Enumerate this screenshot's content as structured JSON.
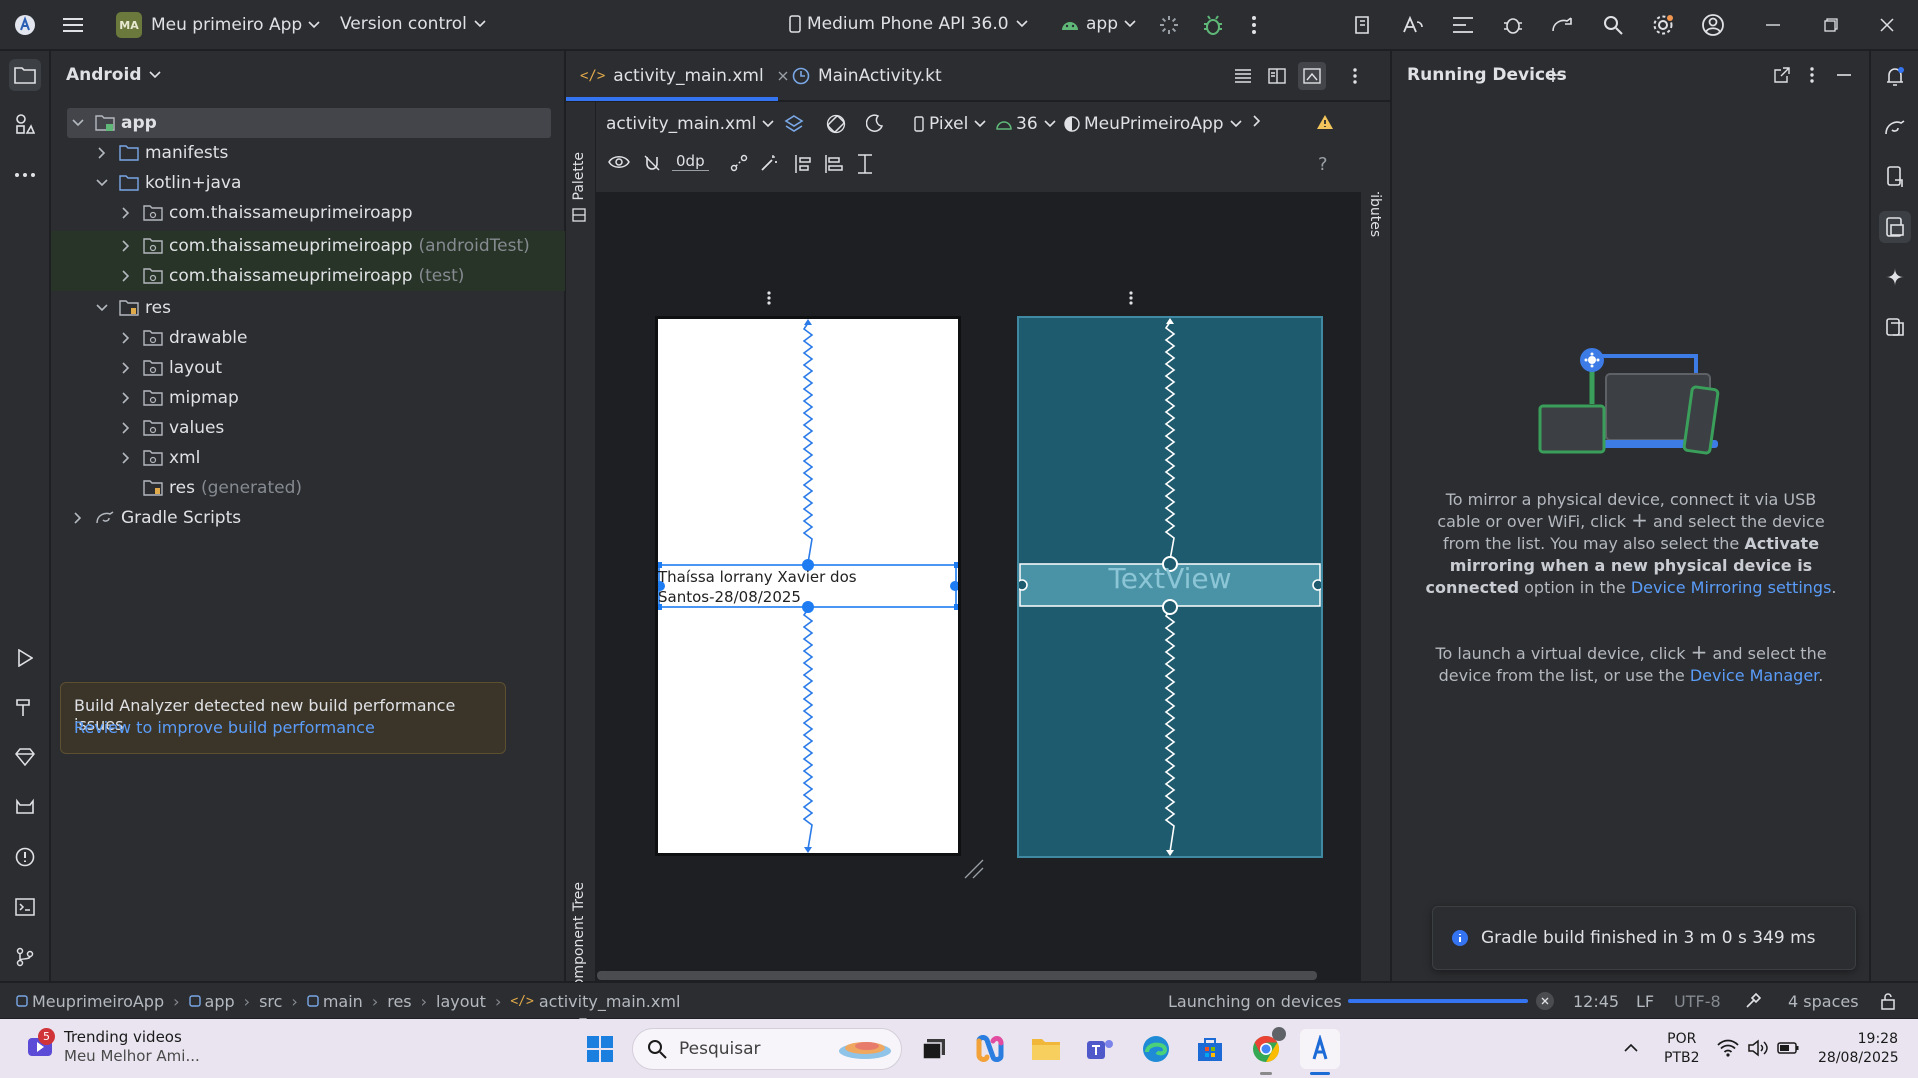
{
  "titlebar": {
    "project_initials": "MA",
    "project_name": "Meu primeiro App",
    "vcs": "Version control",
    "device": "Medium Phone API 36.0",
    "run_config": "app"
  },
  "project_panel": {
    "view_mode": "Android",
    "tree": [
      {
        "label": "app",
        "muted": ""
      },
      {
        "label": "manifests",
        "muted": ""
      },
      {
        "label": "kotlin+java",
        "muted": ""
      },
      {
        "label": "com.thaissameuprimeiroapp",
        "muted": ""
      },
      {
        "label": "com.thaissameuprimeiroapp",
        "muted": "(androidTest)"
      },
      {
        "label": "com.thaissameuprimeiroapp",
        "muted": "(test)"
      },
      {
        "label": "res",
        "muted": ""
      },
      {
        "label": "drawable",
        "muted": ""
      },
      {
        "label": "layout",
        "muted": ""
      },
      {
        "label": "mipmap",
        "muted": ""
      },
      {
        "label": "values",
        "muted": ""
      },
      {
        "label": "xml",
        "muted": ""
      },
      {
        "label": "res",
        "muted": "(generated)"
      },
      {
        "label": "Gradle Scripts",
        "muted": ""
      }
    ]
  },
  "build_popup": {
    "message": "Build Analyzer detected new build performance issues",
    "link": "Review to improve build performance"
  },
  "editor": {
    "tabs": [
      {
        "label": "activity_main.xml",
        "active": true
      },
      {
        "label": "MainActivity.kt",
        "active": false
      }
    ],
    "layout_file": "activity_main.xml",
    "device": "Pixel",
    "api": "36",
    "theme": "MeuPrimeiroApp",
    "margin": "0dp",
    "palette_label": "Palette",
    "component_tree_label": "Component Tree",
    "attributes_label": "Attributes",
    "design_text": "Thaíssa lorrany Xavier dos Santos-28/08/2025",
    "blueprint_text": "TextView"
  },
  "running_devices": {
    "title": "Running Devices",
    "p1_a": "To mirror a physical device, connect it via USB cable or over WiFi, click",
    "p1_b": "and select the device from the list. You may also select the",
    "p1_bold": "Activate mirroring when a new physical device is connected",
    "p1_c": "option in the",
    "p1_link": "Device Mirroring settings",
    "p2_a": "To launch a virtual device, click",
    "p2_b": "and select the device from the list, or use the",
    "p2_link": "Device Manager"
  },
  "gradle_toast": "Gradle build finished in 3 m 0 s 349 ms",
  "statusbar": {
    "breadcrumb": [
      "MeuprimeiroApp",
      "app",
      "src",
      "main",
      "res",
      "layout",
      "activity_main.xml"
    ],
    "task": "Launching on devices",
    "task_progress": 1.0,
    "position": "12:45",
    "line_sep": "LF",
    "encoding": "UTF-8",
    "indent": "4 spaces"
  },
  "taskbar": {
    "news_badge": "5",
    "news_title": "Trending videos",
    "news_sub": "Meu Melhor Ami...",
    "search_placeholder": "Pesquisar",
    "lang": "POR",
    "layout": "PTB2",
    "time": "19:28",
    "date": "28/08/2025"
  },
  "colors": {
    "accent": "#3574f0",
    "blueprint": "#1f5b6e",
    "selection": "#1d7cf2",
    "link": "#5a9cf8",
    "warning": "#f2c55c"
  }
}
